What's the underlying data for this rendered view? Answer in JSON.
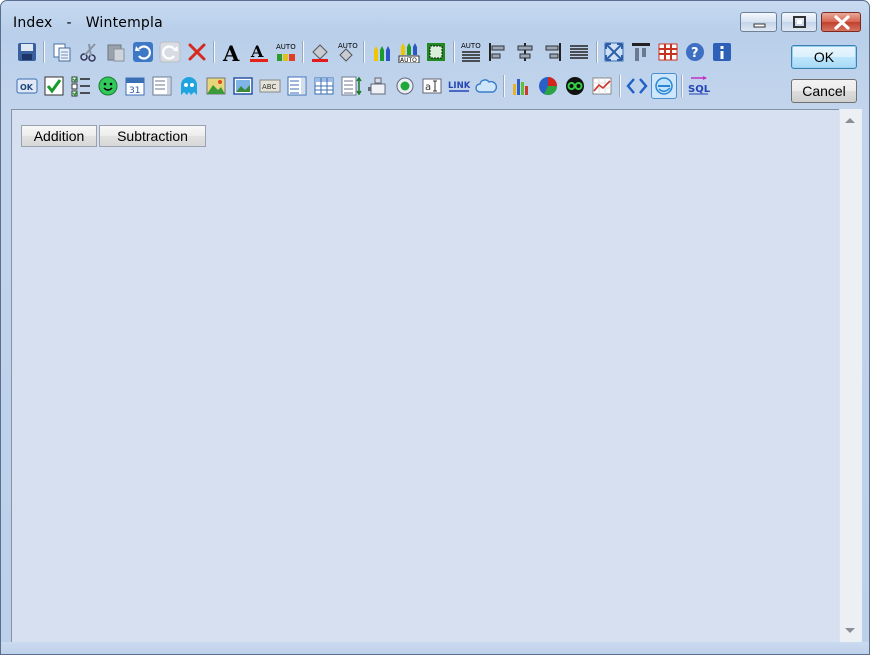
{
  "window": {
    "title": "Index   -   Wintempla",
    "title_color": "#000000",
    "controls": [
      "minimize-icon",
      "maximize-icon",
      "close-icon"
    ]
  },
  "toolbar_row1": [
    "save-icon",
    "copy-icon",
    "cut-icon",
    "paste-icon",
    "undo-icon",
    "redo-icon",
    "delete-icon",
    "font-icon",
    "font-color-icon",
    "auto-color-icon",
    "fill-icon",
    "auto-fill-icon",
    "pencils-icon",
    "auto-pencils-icon",
    "frame-icon",
    "auto-align-icon",
    "align-left-icon",
    "align-center-icon",
    "align-right-icon",
    "justify-icon",
    "resize-icon",
    "text-top-icon",
    "grid-icon",
    "help-icon",
    "info-icon"
  ],
  "toolbar_row2": [
    "ok-button-icon",
    "checkbox-icon",
    "checklist-icon",
    "smiley-icon",
    "calendar-icon",
    "list-icon",
    "ghost-icon",
    "image-icon",
    "picture-icon",
    "label-icon",
    "listbox-icon",
    "table-icon",
    "tree-icon",
    "plugin-icon",
    "radio-icon",
    "textbox-icon",
    "link-icon",
    "cloud-icon",
    "bar-chart-icon",
    "pie-chart-icon",
    "loop-icon",
    "line-chart-icon",
    "code-icon",
    "web-icon",
    "sql-icon"
  ],
  "icon_text": {
    "auto": "AUTO",
    "ok": "OK",
    "cal": "31",
    "abc": "ABC",
    "link": "LINK",
    "sql": "SQL"
  },
  "dialog_buttons": {
    "ok_label": "OK",
    "cancel_label": "Cancel"
  },
  "form": {
    "buttons": [
      {
        "label": "Addition"
      },
      {
        "label": "Subtraction"
      }
    ],
    "background": "#d6e0f0"
  }
}
